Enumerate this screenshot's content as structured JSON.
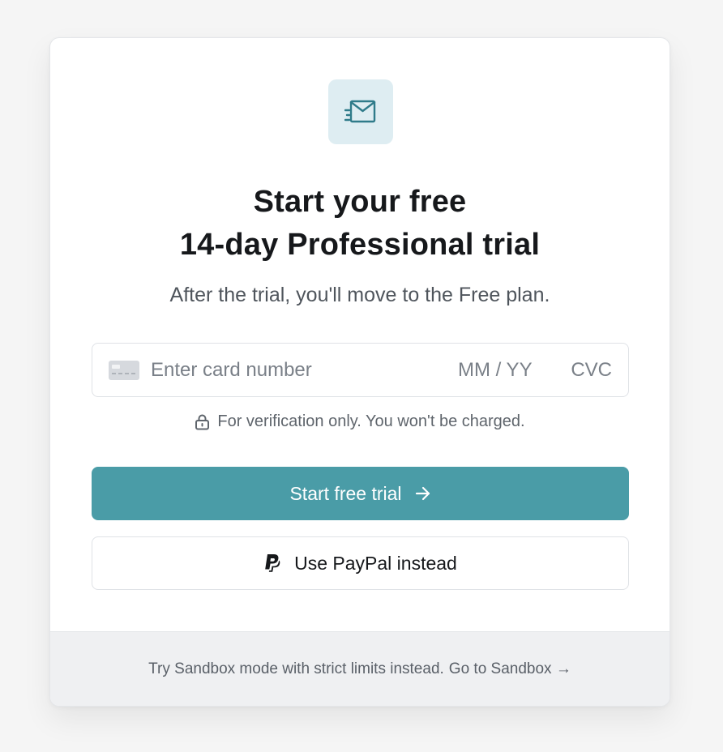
{
  "badge": {
    "icon": "mail-send-icon",
    "color": "#2f7b8a",
    "background": "#deedf2"
  },
  "header": {
    "title_line1": "Start your free",
    "title_line2": "14-day Professional trial",
    "subtitle": "After the trial, you'll move to the Free plan."
  },
  "payment": {
    "card_icon": "credit-card-icon",
    "card_number_placeholder": "Enter card number",
    "expiry_placeholder": "MM / YY",
    "cvc_placeholder": "CVC",
    "verification_icon": "lock-icon",
    "verification_note": "For verification only. You won't be charged."
  },
  "actions": {
    "primary_label": "Start free trial",
    "primary_icon": "arrow-right-icon",
    "primary_color": "#4a9ca7",
    "paypal_label": "Use PayPal instead",
    "paypal_icon": "paypal-icon"
  },
  "footer": {
    "text": "Try Sandbox mode with strict limits instead.",
    "link_label": "Go to Sandbox →"
  }
}
